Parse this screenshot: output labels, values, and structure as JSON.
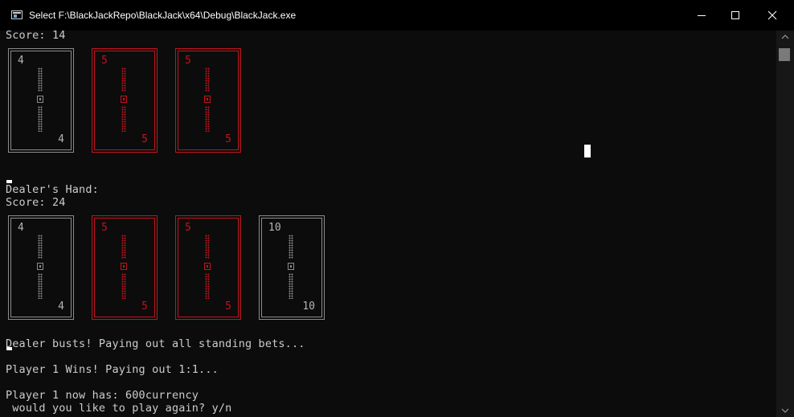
{
  "window": {
    "title": "Select F:\\BlackJackRepo\\BlackJack\\x64\\Debug\\BlackJack.exe",
    "icon": "console-app-icon",
    "controls": [
      "minimize-icon",
      "maximize-icon",
      "close-icon"
    ]
  },
  "console": {
    "player_score": "Score: 14",
    "player_cards": [
      {
        "rank": "4",
        "color": "black"
      },
      {
        "rank": "5",
        "color": "red"
      },
      {
        "rank": "5",
        "color": "red"
      }
    ],
    "dealer_heading": "Dealer's Hand:",
    "dealer_score": "Score: 24",
    "dealer_cards": [
      {
        "rank": "4",
        "color": "black"
      },
      {
        "rank": "5",
        "color": "red"
      },
      {
        "rank": "5",
        "color": "red"
      },
      {
        "rank": "10",
        "color": "black"
      }
    ],
    "messages": {
      "dealer_busts": "Dealer busts! Paying out all standing bets...",
      "player_wins": "Player 1 Wins! Paying out 1:1...",
      "player_balance": "Player 1 now has: 600currency",
      "play_again_prompt": " would you like to play again? y/n"
    }
  },
  "colors": {
    "background": "#0c0c0c",
    "text": "#cccccc",
    "red_card": "#c0141e",
    "black_card": "#8c8c8c"
  }
}
